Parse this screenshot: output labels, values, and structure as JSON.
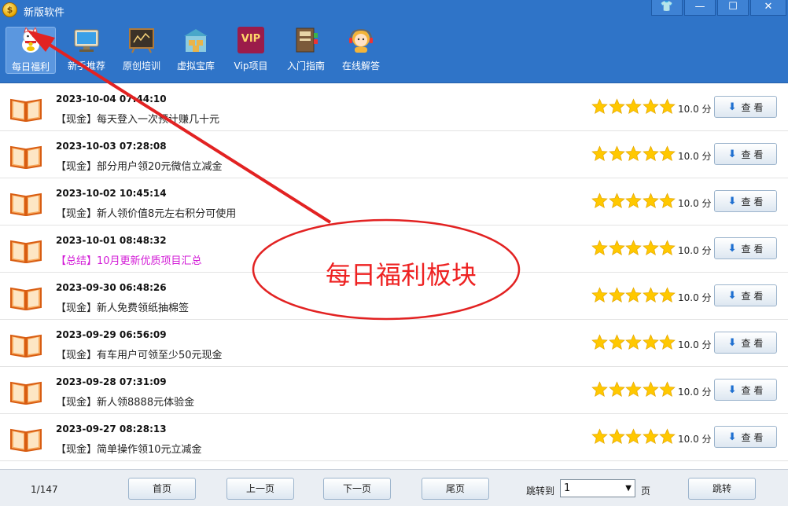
{
  "window": {
    "title": "新版软件",
    "app_icon_glyph": "$",
    "controls": {
      "skin": "👕",
      "minimize": "—",
      "maximize": "☐",
      "close": "✕"
    }
  },
  "toolbar": {
    "items": [
      {
        "label": "每日福利",
        "icon": "lucky-cat-icon",
        "active": true
      },
      {
        "label": "新手推荐",
        "icon": "monitor-icon"
      },
      {
        "label": "原创培训",
        "icon": "blackboard-icon"
      },
      {
        "label": "虚拟宝库",
        "icon": "warehouse-icon"
      },
      {
        "label": "Vip项目",
        "icon": "vip-icon",
        "badge": "VIP"
      },
      {
        "label": "入门指南",
        "icon": "book-guide-icon"
      },
      {
        "label": "在线解答",
        "icon": "support-agent-icon"
      }
    ]
  },
  "list": {
    "score_unit": "分",
    "view_label": "查 看",
    "rows": [
      {
        "date": "2023-10-04 07:44:10",
        "title": "【现金】每天登入一次预计赚几十元",
        "score": "10.0",
        "stars": 5
      },
      {
        "date": "2023-10-03 07:28:08",
        "title": "【现金】部分用户领20元微信立减金",
        "score": "10.0",
        "stars": 5
      },
      {
        "date": "2023-10-02 10:45:14",
        "title": "【现金】新人领价值8元左右积分可使用",
        "score": "10.0",
        "stars": 5
      },
      {
        "date": "2023-10-01 08:48:32",
        "title": "【总结】10月更新优质项目汇总",
        "score": "10.0",
        "stars": 5,
        "highlight": true
      },
      {
        "date": "2023-09-30 06:48:26",
        "title": "【现金】新人免费领纸抽棉签",
        "score": "10.0",
        "stars": 5
      },
      {
        "date": "2023-09-29 06:56:09",
        "title": "【现金】有车用户可领至少50元现金",
        "score": "10.0",
        "stars": 5
      },
      {
        "date": "2023-09-28 07:31:09",
        "title": "【现金】新人领8888元体验金",
        "score": "10.0",
        "stars": 5
      },
      {
        "date": "2023-09-27 08:28:13",
        "title": "【现金】简单操作领10元立减金",
        "score": "10.0",
        "stars": 5
      }
    ]
  },
  "footer": {
    "page_info": "1/147",
    "first": "首页",
    "prev": "上一页",
    "next": "下一页",
    "last": "尾页",
    "jump_to": "跳转到",
    "page_value": "1",
    "page_unit": "页",
    "jump": "跳转"
  },
  "annotation": {
    "text": "每日福利板块",
    "color": "#e22222"
  },
  "colors": {
    "titlebar": "#2f74c8",
    "accent_blue": "#1e6fd0",
    "star": "#ffc800",
    "highlight_title": "#d21ad6"
  }
}
